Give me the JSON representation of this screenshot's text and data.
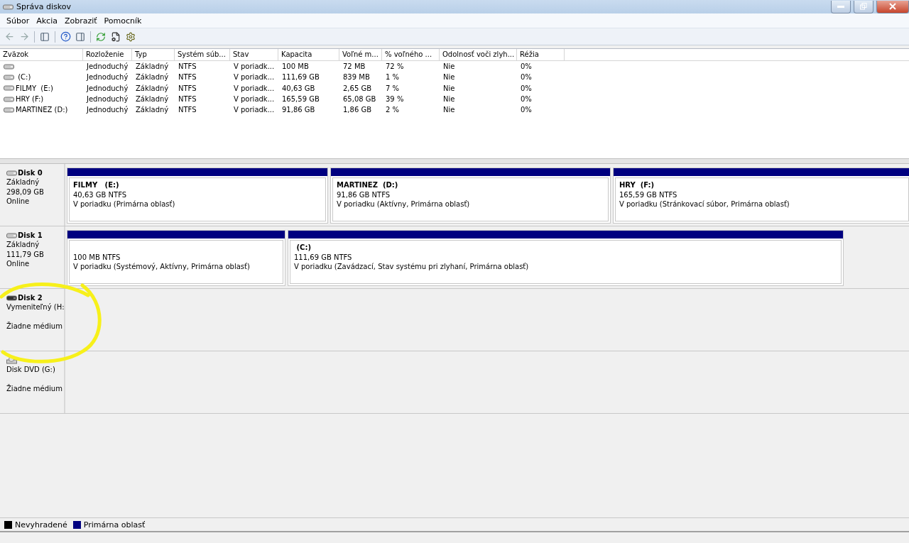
{
  "window": {
    "title": "Správa diskov"
  },
  "menu": [
    "Súbor",
    "Akcia",
    "Zobraziť",
    "Pomocník"
  ],
  "table": {
    "columns": [
      "Zväzok",
      "Rozloženie",
      "Typ",
      "Systém súb...",
      "Stav",
      "Kapacita",
      "Voľné m...",
      "% voľného ...",
      "Odolnosť voči zlyh...",
      "Réžia"
    ],
    "rows": [
      {
        "cells": [
          "",
          "Jednoduchý",
          "Základný",
          "NTFS",
          "V poriadk...",
          "100 MB",
          "72 MB",
          "72 %",
          "Nie",
          "0%"
        ]
      },
      {
        "cells": [
          " (C:)",
          "Jednoduchý",
          "Základný",
          "NTFS",
          "V poriadk...",
          "111,69 GB",
          "839 MB",
          "1 %",
          "Nie",
          "0%"
        ]
      },
      {
        "cells": [
          "FILMY  (E:)",
          "Jednoduchý",
          "Základný",
          "NTFS",
          "V poriadk...",
          "40,63 GB",
          "2,65 GB",
          "7 %",
          "Nie",
          "0%"
        ]
      },
      {
        "cells": [
          "HRY (F:)",
          "Jednoduchý",
          "Základný",
          "NTFS",
          "V poriadk...",
          "165,59 GB",
          "65,08 GB",
          "39 %",
          "Nie",
          "0%"
        ]
      },
      {
        "cells": [
          "MARTINEZ (D:)",
          "Jednoduchý",
          "Základný",
          "NTFS",
          "V poriadk...",
          "91,86 GB",
          "1,86 GB",
          "2 %",
          "Nie",
          "0%"
        ]
      }
    ]
  },
  "disks": [
    {
      "kind": "basic",
      "title": "Disk 0",
      "type": "Základný",
      "size": "298,09 GB",
      "status": "Online",
      "partitions": [
        {
          "name": "FILMY   (E:)",
          "size": "40,63 GB NTFS",
          "status": "V poriadku (Primárna oblasť)"
        },
        {
          "name": "MARTINEZ  (D:)",
          "size": "91,86 GB NTFS",
          "status": "V poriadku (Aktívny, Primárna oblasť)"
        },
        {
          "name": "HRY  (F:)",
          "size": "165,59 GB NTFS",
          "status": "V poriadku (Stránkovací súbor, Primárna oblasť)"
        }
      ]
    },
    {
      "kind": "basic",
      "title": "Disk 1",
      "type": "Základný",
      "size": "111,79 GB",
      "status": "Online",
      "partitions": [
        {
          "size": "100 MB NTFS",
          "status": "V poriadku (Systémový, Aktívny, Primárna oblasť)"
        },
        {
          "name": " (C:)",
          "size": "111,69 GB NTFS",
          "status": "V poriadku (Zavádzací, Stav systému pri zlyhaní, Primárna oblasť)"
        }
      ]
    },
    {
      "kind": "removable",
      "title": "Disk 2",
      "type": "Vymeniteľný (H:",
      "status": "Žiadne médium"
    },
    {
      "kind": "cdrom",
      "type": "Disk DVD (G:)",
      "status": "Žiadne médium"
    }
  ],
  "legend": [
    {
      "label": "Nevyhradené",
      "color": "#000000"
    },
    {
      "label": "Primárna oblasť",
      "color": "#000080"
    }
  ]
}
